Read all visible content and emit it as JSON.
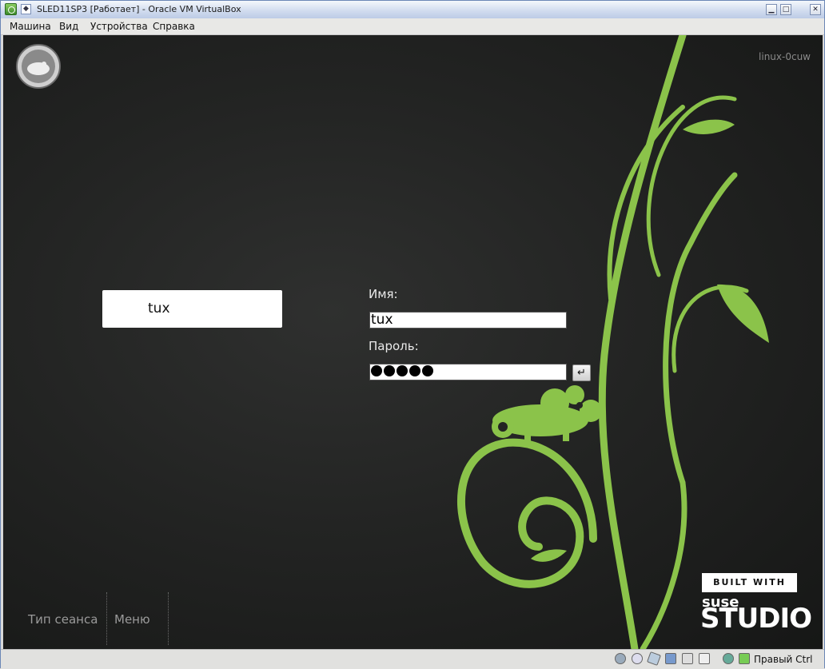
{
  "window": {
    "title": "SLED11SP3 [Работает] - Oracle VM VirtualBox",
    "menu_icon_glyph": "◆",
    "minimize_glyph": "▁",
    "maximize_glyph": "□",
    "close_glyph": "✕"
  },
  "menubar": {
    "items": [
      {
        "label": "Машина"
      },
      {
        "label": "Вид"
      },
      {
        "label": "Устройства"
      },
      {
        "label": "Справка"
      }
    ]
  },
  "login": {
    "hostname": "linux-0cuw",
    "user_list": [
      {
        "name": "tux"
      }
    ],
    "name_label": "Имя:",
    "name_value": "tux",
    "password_label": "Пароль:",
    "password_dots": 5,
    "submit_glyph": "↵"
  },
  "bottom": {
    "session_label": "Тип сеанса",
    "menu_label": "Меню"
  },
  "branding": {
    "built_with": "BUILT WITH",
    "suse": "suse",
    "studio": "STUDIO",
    "accent_color": "#8bc34a"
  },
  "statusbar": {
    "icons": [
      "hard-disk-icon",
      "optical-drive-icon",
      "usb-icon",
      "network-icon",
      "shared-folders-icon",
      "video-capture-icon",
      "virtualization-icon",
      "mouse-integration-icon"
    ],
    "host_key": "Правый Ctrl"
  }
}
